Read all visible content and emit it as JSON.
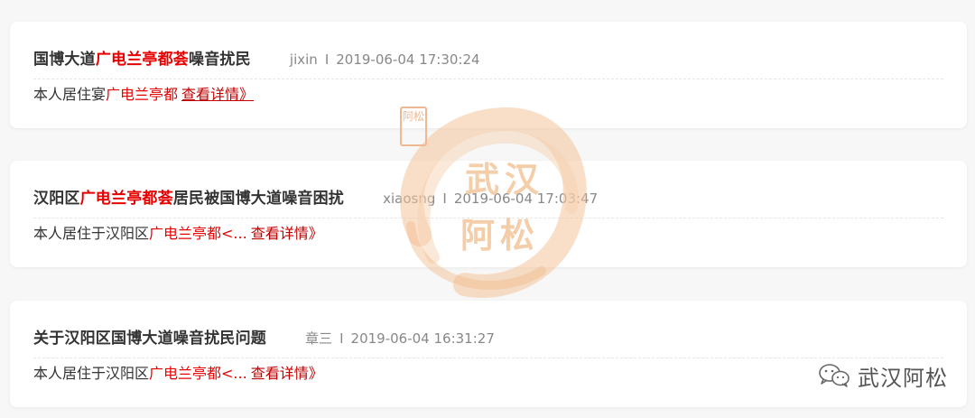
{
  "posts": [
    {
      "title_pre": "国博大道",
      "title_hl": "广电兰亭都荟",
      "title_post": "噪音扰民",
      "author": "jixin",
      "separator": "I",
      "time": "2019-06-04 17:30:24",
      "summary_pre": "本人居住宴",
      "summary_hl": "广电兰亭都",
      "more": "查看详情》"
    },
    {
      "title_pre": "汉阳区",
      "title_hl": "广电兰亭都荟",
      "title_post": "居民被国博大道噪音困扰",
      "author": "xiaosng",
      "separator": "I",
      "time": "2019-06-04 17:03:47",
      "summary_pre": "本人居住于汉阳区",
      "summary_hl": "广电兰亭都<...",
      "more": "查看详情》"
    },
    {
      "title_pre": "关于汉阳区国博大道噪音扰民问题",
      "title_hl": "",
      "title_post": "",
      "author": "章三",
      "separator": "I",
      "time": "2019-06-04 16:31:27",
      "summary_pre": "本人居住于汉阳区",
      "summary_hl": "广电兰亭都<...",
      "more": "查看详情》"
    }
  ],
  "watermark": {
    "line1": "武汉",
    "line2": "阿松",
    "seal": "阿松"
  },
  "brand": {
    "name": "武汉阿松",
    "icon": "wechat-icon"
  },
  "colors": {
    "highlight": "#e60000",
    "link": "#c00000",
    "meta": "#888888"
  }
}
